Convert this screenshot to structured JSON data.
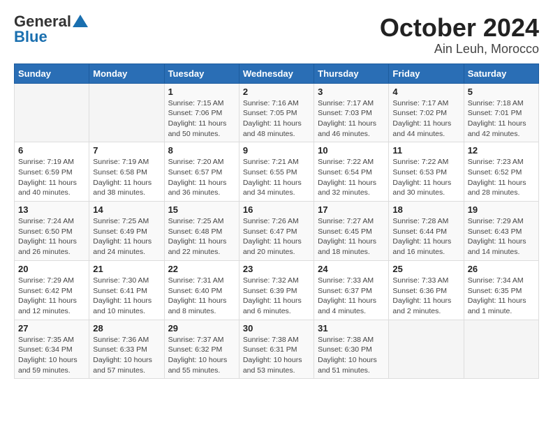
{
  "header": {
    "logo_general": "General",
    "logo_blue": "Blue",
    "month": "October 2024",
    "location": "Ain Leuh, Morocco"
  },
  "columns": [
    "Sunday",
    "Monday",
    "Tuesday",
    "Wednesday",
    "Thursday",
    "Friday",
    "Saturday"
  ],
  "weeks": [
    [
      {
        "day": "",
        "info": ""
      },
      {
        "day": "",
        "info": ""
      },
      {
        "day": "1",
        "info": "Sunrise: 7:15 AM\nSunset: 7:06 PM\nDaylight: 11 hours and 50 minutes."
      },
      {
        "day": "2",
        "info": "Sunrise: 7:16 AM\nSunset: 7:05 PM\nDaylight: 11 hours and 48 minutes."
      },
      {
        "day": "3",
        "info": "Sunrise: 7:17 AM\nSunset: 7:03 PM\nDaylight: 11 hours and 46 minutes."
      },
      {
        "day": "4",
        "info": "Sunrise: 7:17 AM\nSunset: 7:02 PM\nDaylight: 11 hours and 44 minutes."
      },
      {
        "day": "5",
        "info": "Sunrise: 7:18 AM\nSunset: 7:01 PM\nDaylight: 11 hours and 42 minutes."
      }
    ],
    [
      {
        "day": "6",
        "info": "Sunrise: 7:19 AM\nSunset: 6:59 PM\nDaylight: 11 hours and 40 minutes."
      },
      {
        "day": "7",
        "info": "Sunrise: 7:19 AM\nSunset: 6:58 PM\nDaylight: 11 hours and 38 minutes."
      },
      {
        "day": "8",
        "info": "Sunrise: 7:20 AM\nSunset: 6:57 PM\nDaylight: 11 hours and 36 minutes."
      },
      {
        "day": "9",
        "info": "Sunrise: 7:21 AM\nSunset: 6:55 PM\nDaylight: 11 hours and 34 minutes."
      },
      {
        "day": "10",
        "info": "Sunrise: 7:22 AM\nSunset: 6:54 PM\nDaylight: 11 hours and 32 minutes."
      },
      {
        "day": "11",
        "info": "Sunrise: 7:22 AM\nSunset: 6:53 PM\nDaylight: 11 hours and 30 minutes."
      },
      {
        "day": "12",
        "info": "Sunrise: 7:23 AM\nSunset: 6:52 PM\nDaylight: 11 hours and 28 minutes."
      }
    ],
    [
      {
        "day": "13",
        "info": "Sunrise: 7:24 AM\nSunset: 6:50 PM\nDaylight: 11 hours and 26 minutes."
      },
      {
        "day": "14",
        "info": "Sunrise: 7:25 AM\nSunset: 6:49 PM\nDaylight: 11 hours and 24 minutes."
      },
      {
        "day": "15",
        "info": "Sunrise: 7:25 AM\nSunset: 6:48 PM\nDaylight: 11 hours and 22 minutes."
      },
      {
        "day": "16",
        "info": "Sunrise: 7:26 AM\nSunset: 6:47 PM\nDaylight: 11 hours and 20 minutes."
      },
      {
        "day": "17",
        "info": "Sunrise: 7:27 AM\nSunset: 6:45 PM\nDaylight: 11 hours and 18 minutes."
      },
      {
        "day": "18",
        "info": "Sunrise: 7:28 AM\nSunset: 6:44 PM\nDaylight: 11 hours and 16 minutes."
      },
      {
        "day": "19",
        "info": "Sunrise: 7:29 AM\nSunset: 6:43 PM\nDaylight: 11 hours and 14 minutes."
      }
    ],
    [
      {
        "day": "20",
        "info": "Sunrise: 7:29 AM\nSunset: 6:42 PM\nDaylight: 11 hours and 12 minutes."
      },
      {
        "day": "21",
        "info": "Sunrise: 7:30 AM\nSunset: 6:41 PM\nDaylight: 11 hours and 10 minutes."
      },
      {
        "day": "22",
        "info": "Sunrise: 7:31 AM\nSunset: 6:40 PM\nDaylight: 11 hours and 8 minutes."
      },
      {
        "day": "23",
        "info": "Sunrise: 7:32 AM\nSunset: 6:39 PM\nDaylight: 11 hours and 6 minutes."
      },
      {
        "day": "24",
        "info": "Sunrise: 7:33 AM\nSunset: 6:37 PM\nDaylight: 11 hours and 4 minutes."
      },
      {
        "day": "25",
        "info": "Sunrise: 7:33 AM\nSunset: 6:36 PM\nDaylight: 11 hours and 2 minutes."
      },
      {
        "day": "26",
        "info": "Sunrise: 7:34 AM\nSunset: 6:35 PM\nDaylight: 11 hours and 1 minute."
      }
    ],
    [
      {
        "day": "27",
        "info": "Sunrise: 7:35 AM\nSunset: 6:34 PM\nDaylight: 10 hours and 59 minutes."
      },
      {
        "day": "28",
        "info": "Sunrise: 7:36 AM\nSunset: 6:33 PM\nDaylight: 10 hours and 57 minutes."
      },
      {
        "day": "29",
        "info": "Sunrise: 7:37 AM\nSunset: 6:32 PM\nDaylight: 10 hours and 55 minutes."
      },
      {
        "day": "30",
        "info": "Sunrise: 7:38 AM\nSunset: 6:31 PM\nDaylight: 10 hours and 53 minutes."
      },
      {
        "day": "31",
        "info": "Sunrise: 7:38 AM\nSunset: 6:30 PM\nDaylight: 10 hours and 51 minutes."
      },
      {
        "day": "",
        "info": ""
      },
      {
        "day": "",
        "info": ""
      }
    ]
  ]
}
